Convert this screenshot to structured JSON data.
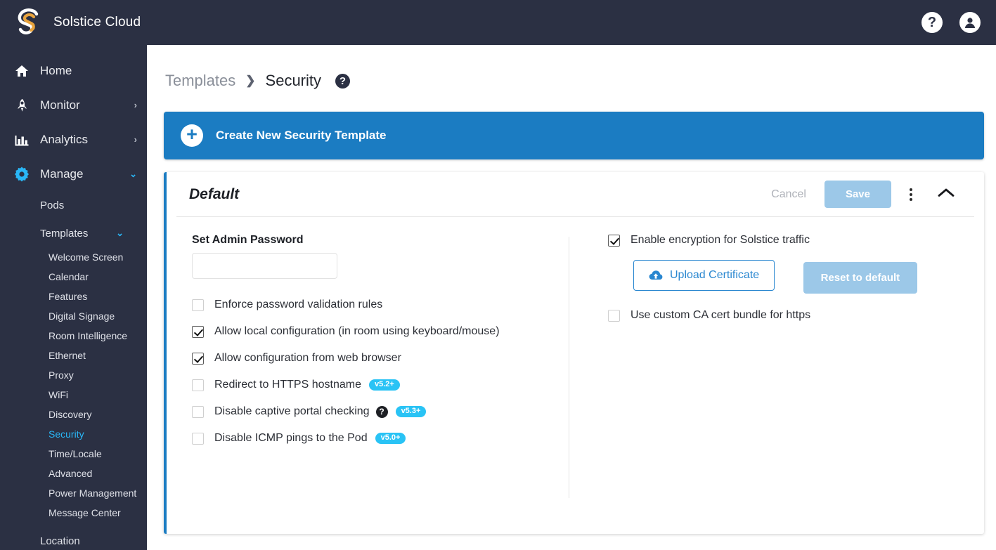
{
  "app": {
    "brand_name": "Solstice Cloud",
    "logo_icon": "solstice-s-logo",
    "help_icon": "question-mark-icon",
    "account_icon": "user-account-icon"
  },
  "sidebar": {
    "top_items": [
      {
        "label": "Home",
        "icon": "home-icon",
        "chevron": "",
        "active": false
      },
      {
        "label": "Monitor",
        "icon": "rocket-icon",
        "chevron": "›",
        "active": false
      },
      {
        "label": "Analytics",
        "icon": "bar-chart-icon",
        "chevron": "›",
        "active": false
      },
      {
        "label": "Manage",
        "icon": "gear-icon",
        "chevron": "⌄",
        "active": true
      }
    ],
    "manage_children": [
      {
        "label": "Pods",
        "chevron": ""
      },
      {
        "label": "Templates",
        "chevron": "⌄"
      }
    ],
    "template_items": [
      {
        "label": "Welcome Screen",
        "selected": false
      },
      {
        "label": "Calendar",
        "selected": false
      },
      {
        "label": "Features",
        "selected": false
      },
      {
        "label": "Digital Signage",
        "selected": false
      },
      {
        "label": "Room Intelligence",
        "selected": false
      },
      {
        "label": "Ethernet",
        "selected": false
      },
      {
        "label": "Proxy",
        "selected": false
      },
      {
        "label": "WiFi",
        "selected": false
      },
      {
        "label": "Discovery",
        "selected": false
      },
      {
        "label": "Security",
        "selected": true
      },
      {
        "label": "Time/Locale",
        "selected": false
      },
      {
        "label": "Advanced",
        "selected": false
      },
      {
        "label": "Power Management",
        "selected": false
      },
      {
        "label": "Message Center",
        "selected": false
      }
    ],
    "footer_items": [
      {
        "label": "Location"
      }
    ]
  },
  "breadcrumb": {
    "parent": "Templates",
    "separator": "❯",
    "current": "Security",
    "help_icon": "question-mark-icon"
  },
  "create_banner": {
    "label": "Create New Security Template",
    "plus_icon": "plus-icon"
  },
  "card": {
    "title": "Default",
    "cancel_label": "Cancel",
    "save_label": "Save",
    "kebab_icon": "more-vertical-icon",
    "collapse_icon": "chevron-up-icon",
    "accent_color": "#1b7cc2"
  },
  "left_column": {
    "password_label": "Set Admin Password",
    "password_value": "",
    "password_placeholder": "",
    "options": [
      {
        "label": "Enforce password validation rules",
        "checked": false,
        "badge": "",
        "help": false
      },
      {
        "label": "Allow local configuration (in room using keyboard/mouse)",
        "checked": true,
        "badge": "",
        "help": false
      },
      {
        "label": "Allow configuration from web browser",
        "checked": true,
        "badge": "",
        "help": false
      },
      {
        "label": "Redirect to HTTPS hostname",
        "checked": false,
        "badge": "v5.2+",
        "help": false
      },
      {
        "label": "Disable captive portal checking",
        "checked": false,
        "badge": "v5.3+",
        "help": true
      },
      {
        "label": "Disable ICMP pings to the Pod",
        "checked": false,
        "badge": "v5.0+",
        "help": false
      }
    ]
  },
  "right_column": {
    "encryption": {
      "label": "Enable encryption for Solstice traffic",
      "checked": true
    },
    "upload_label": "Upload Certificate",
    "upload_icon": "cloud-upload-icon",
    "reset_label": "Reset to default",
    "ca_bundle": {
      "label": "Use custom CA cert bundle for https",
      "checked": false
    }
  },
  "colors": {
    "sidebar_bg": "#2b3043",
    "accent_blue": "#1b7cc2",
    "highlight_cyan": "#29b6f6",
    "badge_cyan": "#29c3f5",
    "disabled_blue": "#9cc8e8"
  }
}
